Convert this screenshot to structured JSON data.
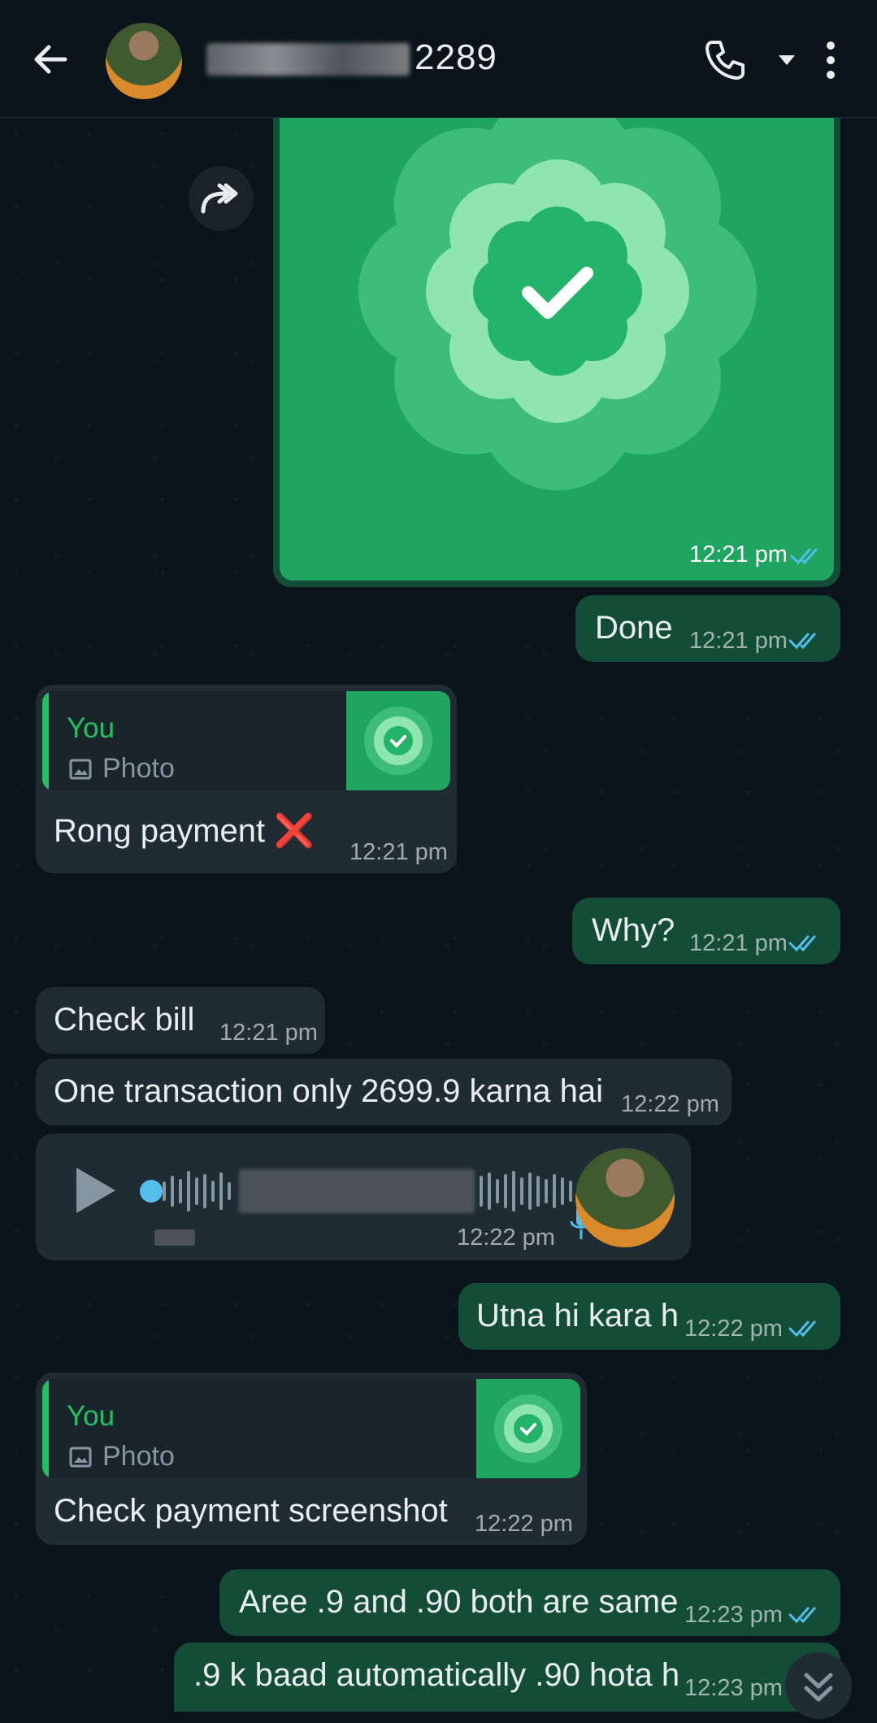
{
  "header": {
    "contact_suffix": "2289",
    "back_icon": "arrow-left-icon",
    "call_icon": "phone-icon",
    "dropdown_icon": "caret-down-icon",
    "menu_icon": "more-vertical-icon"
  },
  "messages": {
    "image_time": "12:21 pm",
    "done": {
      "text": "Done",
      "time": "12:21 pm"
    },
    "rong": {
      "reply_author": "You",
      "reply_type": "Photo",
      "text": "Rong payment ❌",
      "time": "12:21 pm"
    },
    "why": {
      "text": "Why?",
      "time": "12:21 pm"
    },
    "check_bill": {
      "text": "Check bill",
      "time": "12:21 pm"
    },
    "one_txn": {
      "text": "One transaction only 2699.9 karna hai",
      "time": "12:22 pm"
    },
    "voice": {
      "time": "12:22 pm"
    },
    "utna": {
      "text": "Utna hi kara h",
      "time": "12:22 pm"
    },
    "check_ss": {
      "reply_author": "You",
      "reply_type": "Photo",
      "text": "Check payment screenshot",
      "time": "12:22 pm"
    },
    "aree": {
      "text": "Aree .9 and .90 both are same",
      "time": "12:23 pm"
    },
    "nine_k": {
      "text": ".9 k baad automatically .90 hota h",
      "time": "12:23 pm"
    }
  },
  "colors": {
    "outgoing": "#144d37",
    "incoming": "#1f2c33",
    "accent": "#21c063",
    "read_ticks": "#53bdeb"
  }
}
